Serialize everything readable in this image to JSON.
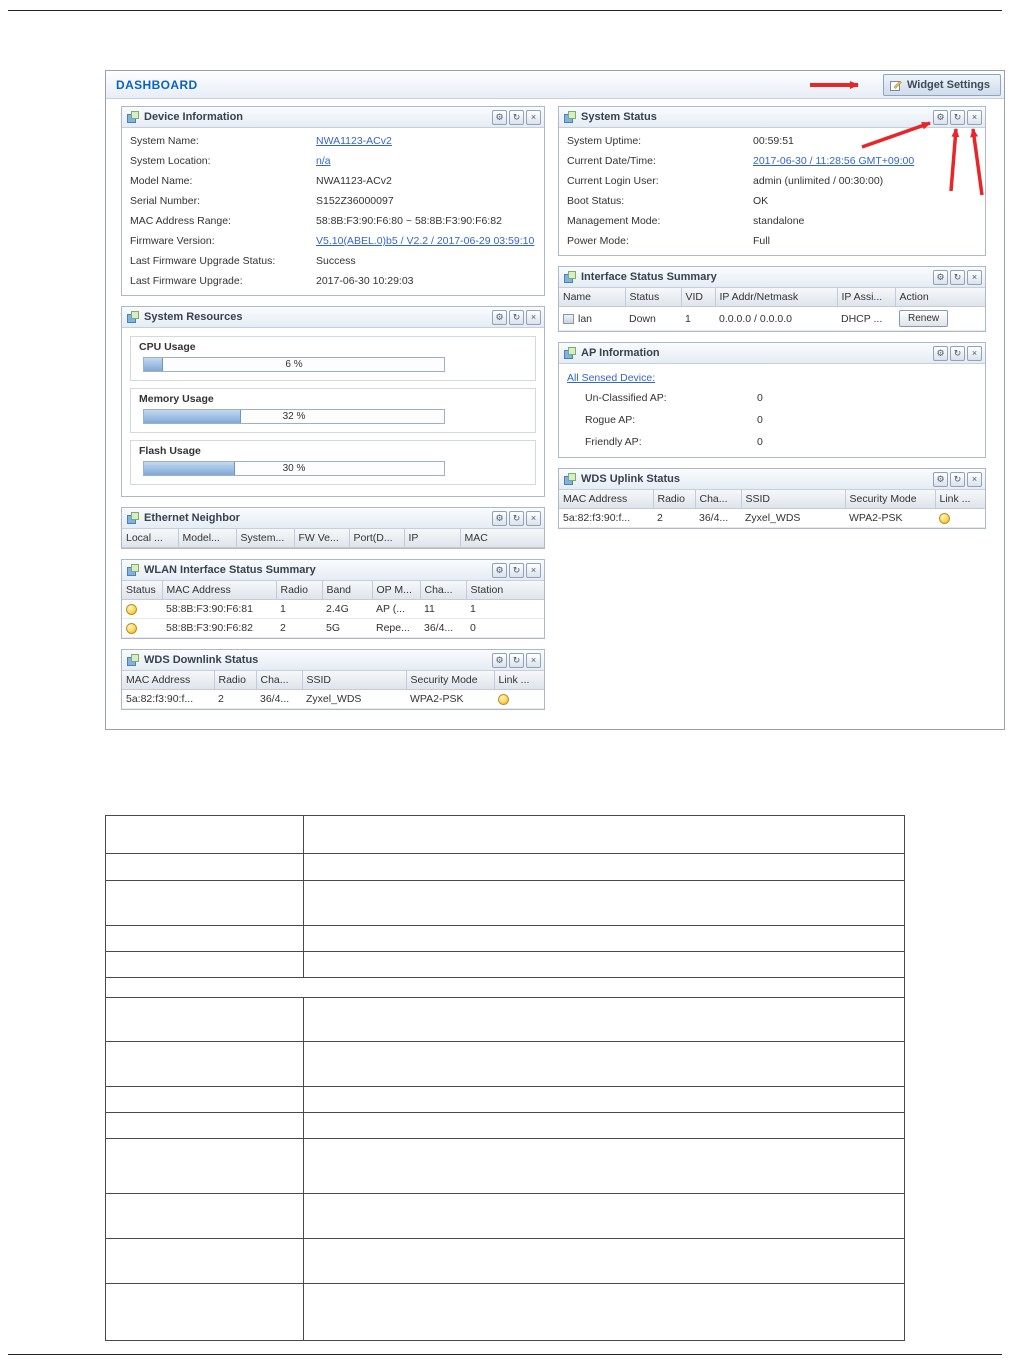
{
  "colors": {
    "title_blue": "#0a62c8",
    "link_blue": "#3366cc",
    "arrow_red": "#e8262a"
  },
  "icons": {
    "gear": "⚙",
    "refresh": "↻",
    "close": "×"
  },
  "dashboard": {
    "title": "DASHBOARD",
    "widget_settings_label": "Widget Settings"
  },
  "device_info": {
    "title": "Device Information",
    "rows": [
      {
        "label": "System Name:",
        "value": "NWA1123-ACv2"
      },
      {
        "label": "System Location:",
        "value": "n/a"
      },
      {
        "label": "Model Name:",
        "value": "NWA1123-ACv2"
      },
      {
        "label": "Serial Number:",
        "value": "S152Z36000097"
      },
      {
        "label": "MAC Address Range:",
        "value": "58:8B:F3:90:F6:80 ~ 58:8B:F3:90:F6:82"
      },
      {
        "label": "Firmware Version:",
        "value": "V5.10(ABEL.0)b5 / V2.2 / 2017-06-29 03:59:10"
      },
      {
        "label": "Last Firmware Upgrade Status:",
        "value": "Success"
      },
      {
        "label": "Last Firmware Upgrade:",
        "value": "2017-06-30 10:29:03"
      }
    ]
  },
  "system_resources": {
    "title": "System Resources",
    "bars": [
      {
        "label": "CPU Usage",
        "percent": 6,
        "text": "6 %"
      },
      {
        "label": "Memory Usage",
        "percent": 32,
        "text": "32 %"
      },
      {
        "label": "Flash Usage",
        "percent": 30,
        "text": "30 %"
      }
    ]
  },
  "ethernet_neighbor": {
    "title": "Ethernet Neighbor",
    "headers": [
      "Local ...",
      "Model...",
      "System...",
      "FW Ve...",
      "Port(D...",
      "IP",
      "MAC"
    ]
  },
  "wlan_summary": {
    "title": "WLAN Interface Status Summary",
    "headers": [
      "Status",
      "MAC Address",
      "Radio",
      "Band",
      "OP M...",
      "Cha...",
      "Station"
    ],
    "rows": [
      {
        "mac": "58:8B:F3:90:F6:81",
        "radio": "1",
        "band": "2.4G",
        "op": "AP (...",
        "channel": "11",
        "station": "1"
      },
      {
        "mac": "58:8B:F3:90:F6:82",
        "radio": "2",
        "band": "5G",
        "op": "Repe...",
        "channel": "36/4...",
        "station": "0"
      }
    ]
  },
  "wds_downlink": {
    "title": "WDS Downlink Status",
    "headers": [
      "MAC Address",
      "Radio",
      "Cha...",
      "SSID",
      "Security Mode",
      "Link ..."
    ],
    "row": {
      "mac": "5a:82:f3:90:f...",
      "radio": "2",
      "channel": "36/4...",
      "ssid": "Zyxel_WDS",
      "security": "WPA2-PSK"
    }
  },
  "system_status": {
    "title": "System Status",
    "rows": [
      {
        "label": "System Uptime:",
        "value": "00:59:51"
      },
      {
        "label": "Current Date/Time:",
        "value": "2017-06-30 / 11:28:56 GMT+09:00"
      },
      {
        "label": "Current Login User:",
        "value": "admin (unlimited / 00:30:00)"
      },
      {
        "label": "Boot Status:",
        "value": "OK"
      },
      {
        "label": "Management Mode:",
        "value": "standalone"
      },
      {
        "label": "Power Mode:",
        "value": "Full"
      }
    ]
  },
  "interface_status": {
    "title": "Interface Status Summary",
    "headers": [
      "Name",
      "Status",
      "VID",
      "IP Addr/Netmask",
      "IP Assi...",
      "Action"
    ],
    "row": {
      "name": "lan",
      "status": "Down",
      "vid": "1",
      "ip": "0.0.0.0 / 0.0.0.0",
      "assign": "DHCP ...",
      "action": "Renew"
    }
  },
  "ap_information": {
    "title": "AP Information",
    "link": "All Sensed Device:",
    "rows": [
      {
        "label": "Un-Classified AP:",
        "value": "0"
      },
      {
        "label": "Rogue AP:",
        "value": "0"
      },
      {
        "label": "Friendly AP:",
        "value": "0"
      }
    ]
  },
  "wds_uplink": {
    "title": "WDS Uplink Status",
    "headers": [
      "MAC Address",
      "Radio",
      "Cha...",
      "SSID",
      "Security Mode",
      "Link ..."
    ],
    "row": {
      "mac": "5a:82:f3:90:f...",
      "radio": "2",
      "channel": "36/4...",
      "ssid": "Zyxel_WDS",
      "security": "WPA2-PSK"
    }
  }
}
